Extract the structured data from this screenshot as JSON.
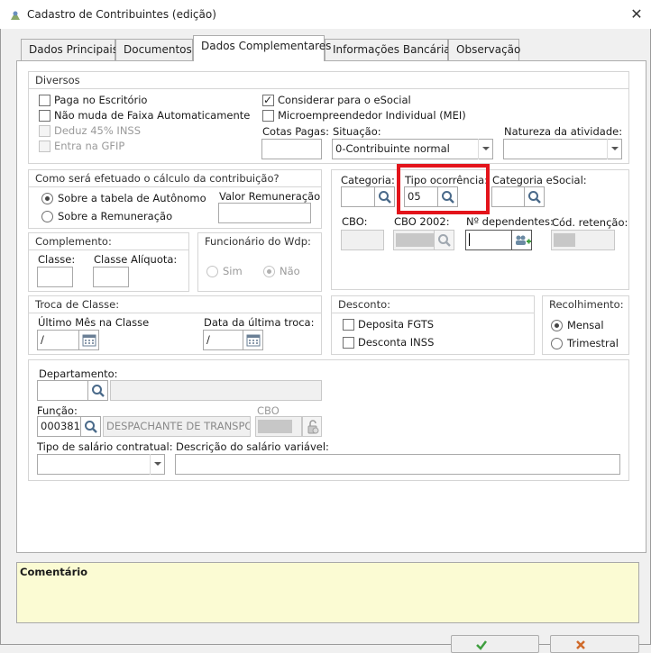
{
  "window": {
    "title": "Cadastro de Contribuintes (edição)",
    "close_glyph": "✕"
  },
  "tabs": [
    {
      "label": "Dados Principais"
    },
    {
      "label": "Documentos"
    },
    {
      "label": "Dados Complementares"
    },
    {
      "label": "Informações Bancárias"
    },
    {
      "label": "Observação"
    }
  ],
  "diversos": {
    "header": "Diversos",
    "paga_escritorio": "Paga no Escritório",
    "nao_muda_faixa": "Não muda de Faixa Automaticamente",
    "deduz_inss": "Deduz 45% INSS",
    "entra_gfip": "Entra na GFIP",
    "considerar_esocial": "Considerar para o eSocial",
    "mei": "Microempreendedor Individual (MEI)",
    "cotas_pagas_label": "Cotas Pagas:",
    "cotas_pagas_value": "",
    "situacao_label": "Situação:",
    "situacao_value": "0-Contribuinte normal",
    "natureza_label": "Natureza da atividade:",
    "natureza_value": ""
  },
  "calculo": {
    "header": "Como será efetuado o cálculo da contribuição?",
    "opt_tabela": "Sobre a tabela de Autônomo",
    "opt_remuneracao": "Sobre a Remuneração",
    "valor_label": "Valor Remuneração",
    "valor_value": ""
  },
  "categoria": {
    "categoria_label": "Categoria:",
    "tipo_ocorrencia_label": "Tipo ocorrência:",
    "tipo_ocorrencia_value": "05",
    "categoria_esocial_label": "Categoria eSocial:",
    "cbo_label": "CBO:",
    "cbo2002_label": "CBO 2002:",
    "dependentes_label": "Nº dependentes:",
    "cod_retencao_label": "Cód. retenção:"
  },
  "complemento": {
    "header": "Complemento:",
    "classe_label": "Classe:",
    "aliquota_label": "Classe Alíquota:"
  },
  "funcionario_wdp": {
    "header": "Funcionário do Wdp:",
    "sim": "Sim",
    "nao": "Não"
  },
  "troca_classe": {
    "header": "Troca de Classe:",
    "ultimo_mes_label": "Último Mês na Classe",
    "ultimo_mes_value": " /",
    "data_troca_label": "Data da última troca:",
    "data_troca_value": " /"
  },
  "desconto": {
    "header": "Desconto:",
    "fgts": "Deposita FGTS",
    "inss": "Desconta INSS"
  },
  "recolhimento": {
    "header": "Recolhimento:",
    "mensal": "Mensal",
    "trimestral": "Trimestral"
  },
  "departamento": {
    "label": "Departamento:",
    "funcao_label": "Função:",
    "funcao_code": "000381",
    "funcao_desc": "DESPACHANTE DE TRANSPOR",
    "cbo_label": "CBO",
    "tipo_salario_label": "Tipo de salário contratual:",
    "desc_salario_label": "Descrição do salário variável:"
  },
  "comentario": {
    "label": "Comentário"
  },
  "colors": {
    "highlight": "#e3141b",
    "comment_bg": "#fbfbd3"
  }
}
